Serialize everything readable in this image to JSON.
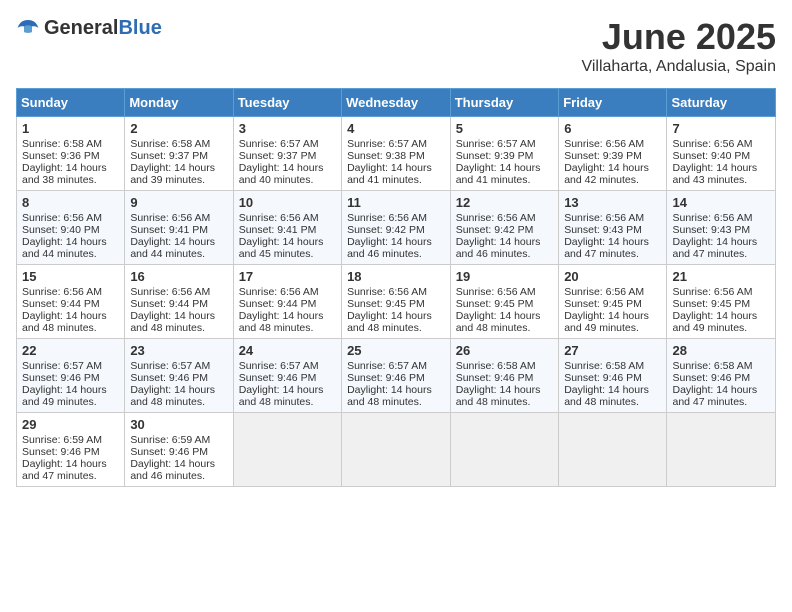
{
  "header": {
    "logo_general": "General",
    "logo_blue": "Blue",
    "title": "June 2025",
    "subtitle": "Villaharta, Andalusia, Spain"
  },
  "calendar": {
    "days_of_week": [
      "Sunday",
      "Monday",
      "Tuesday",
      "Wednesday",
      "Thursday",
      "Friday",
      "Saturday"
    ],
    "weeks": [
      [
        {
          "day": "",
          "empty": true
        },
        {
          "day": "",
          "empty": true
        },
        {
          "day": "",
          "empty": true
        },
        {
          "day": "",
          "empty": true
        },
        {
          "day": "",
          "empty": true
        },
        {
          "day": "",
          "empty": true
        },
        {
          "day": "",
          "empty": true
        }
      ],
      [
        {
          "day": "1",
          "sunrise": "6:58 AM",
          "sunset": "9:36 PM",
          "daylight": "14 hours and 38 minutes."
        },
        {
          "day": "2",
          "sunrise": "6:58 AM",
          "sunset": "9:37 PM",
          "daylight": "14 hours and 39 minutes."
        },
        {
          "day": "3",
          "sunrise": "6:57 AM",
          "sunset": "9:37 PM",
          "daylight": "14 hours and 40 minutes."
        },
        {
          "day": "4",
          "sunrise": "6:57 AM",
          "sunset": "9:38 PM",
          "daylight": "14 hours and 41 minutes."
        },
        {
          "day": "5",
          "sunrise": "6:57 AM",
          "sunset": "9:39 PM",
          "daylight": "14 hours and 41 minutes."
        },
        {
          "day": "6",
          "sunrise": "6:56 AM",
          "sunset": "9:39 PM",
          "daylight": "14 hours and 42 minutes."
        },
        {
          "day": "7",
          "sunrise": "6:56 AM",
          "sunset": "9:40 PM",
          "daylight": "14 hours and 43 minutes."
        }
      ],
      [
        {
          "day": "8",
          "sunrise": "6:56 AM",
          "sunset": "9:40 PM",
          "daylight": "14 hours and 44 minutes."
        },
        {
          "day": "9",
          "sunrise": "6:56 AM",
          "sunset": "9:41 PM",
          "daylight": "14 hours and 44 minutes."
        },
        {
          "day": "10",
          "sunrise": "6:56 AM",
          "sunset": "9:41 PM",
          "daylight": "14 hours and 45 minutes."
        },
        {
          "day": "11",
          "sunrise": "6:56 AM",
          "sunset": "9:42 PM",
          "daylight": "14 hours and 46 minutes."
        },
        {
          "day": "12",
          "sunrise": "6:56 AM",
          "sunset": "9:42 PM",
          "daylight": "14 hours and 46 minutes."
        },
        {
          "day": "13",
          "sunrise": "6:56 AM",
          "sunset": "9:43 PM",
          "daylight": "14 hours and 47 minutes."
        },
        {
          "day": "14",
          "sunrise": "6:56 AM",
          "sunset": "9:43 PM",
          "daylight": "14 hours and 47 minutes."
        }
      ],
      [
        {
          "day": "15",
          "sunrise": "6:56 AM",
          "sunset": "9:44 PM",
          "daylight": "14 hours and 48 minutes."
        },
        {
          "day": "16",
          "sunrise": "6:56 AM",
          "sunset": "9:44 PM",
          "daylight": "14 hours and 48 minutes."
        },
        {
          "day": "17",
          "sunrise": "6:56 AM",
          "sunset": "9:44 PM",
          "daylight": "14 hours and 48 minutes."
        },
        {
          "day": "18",
          "sunrise": "6:56 AM",
          "sunset": "9:45 PM",
          "daylight": "14 hours and 48 minutes."
        },
        {
          "day": "19",
          "sunrise": "6:56 AM",
          "sunset": "9:45 PM",
          "daylight": "14 hours and 48 minutes."
        },
        {
          "day": "20",
          "sunrise": "6:56 AM",
          "sunset": "9:45 PM",
          "daylight": "14 hours and 49 minutes."
        },
        {
          "day": "21",
          "sunrise": "6:56 AM",
          "sunset": "9:45 PM",
          "daylight": "14 hours and 49 minutes."
        }
      ],
      [
        {
          "day": "22",
          "sunrise": "6:57 AM",
          "sunset": "9:46 PM",
          "daylight": "14 hours and 49 minutes."
        },
        {
          "day": "23",
          "sunrise": "6:57 AM",
          "sunset": "9:46 PM",
          "daylight": "14 hours and 48 minutes."
        },
        {
          "day": "24",
          "sunrise": "6:57 AM",
          "sunset": "9:46 PM",
          "daylight": "14 hours and 48 minutes."
        },
        {
          "day": "25",
          "sunrise": "6:57 AM",
          "sunset": "9:46 PM",
          "daylight": "14 hours and 48 minutes."
        },
        {
          "day": "26",
          "sunrise": "6:58 AM",
          "sunset": "9:46 PM",
          "daylight": "14 hours and 48 minutes."
        },
        {
          "day": "27",
          "sunrise": "6:58 AM",
          "sunset": "9:46 PM",
          "daylight": "14 hours and 48 minutes."
        },
        {
          "day": "28",
          "sunrise": "6:58 AM",
          "sunset": "9:46 PM",
          "daylight": "14 hours and 47 minutes."
        }
      ],
      [
        {
          "day": "29",
          "sunrise": "6:59 AM",
          "sunset": "9:46 PM",
          "daylight": "14 hours and 47 minutes."
        },
        {
          "day": "30",
          "sunrise": "6:59 AM",
          "sunset": "9:46 PM",
          "daylight": "14 hours and 46 minutes."
        },
        {
          "day": "",
          "empty": true
        },
        {
          "day": "",
          "empty": true
        },
        {
          "day": "",
          "empty": true
        },
        {
          "day": "",
          "empty": true
        },
        {
          "day": "",
          "empty": true
        }
      ]
    ]
  }
}
